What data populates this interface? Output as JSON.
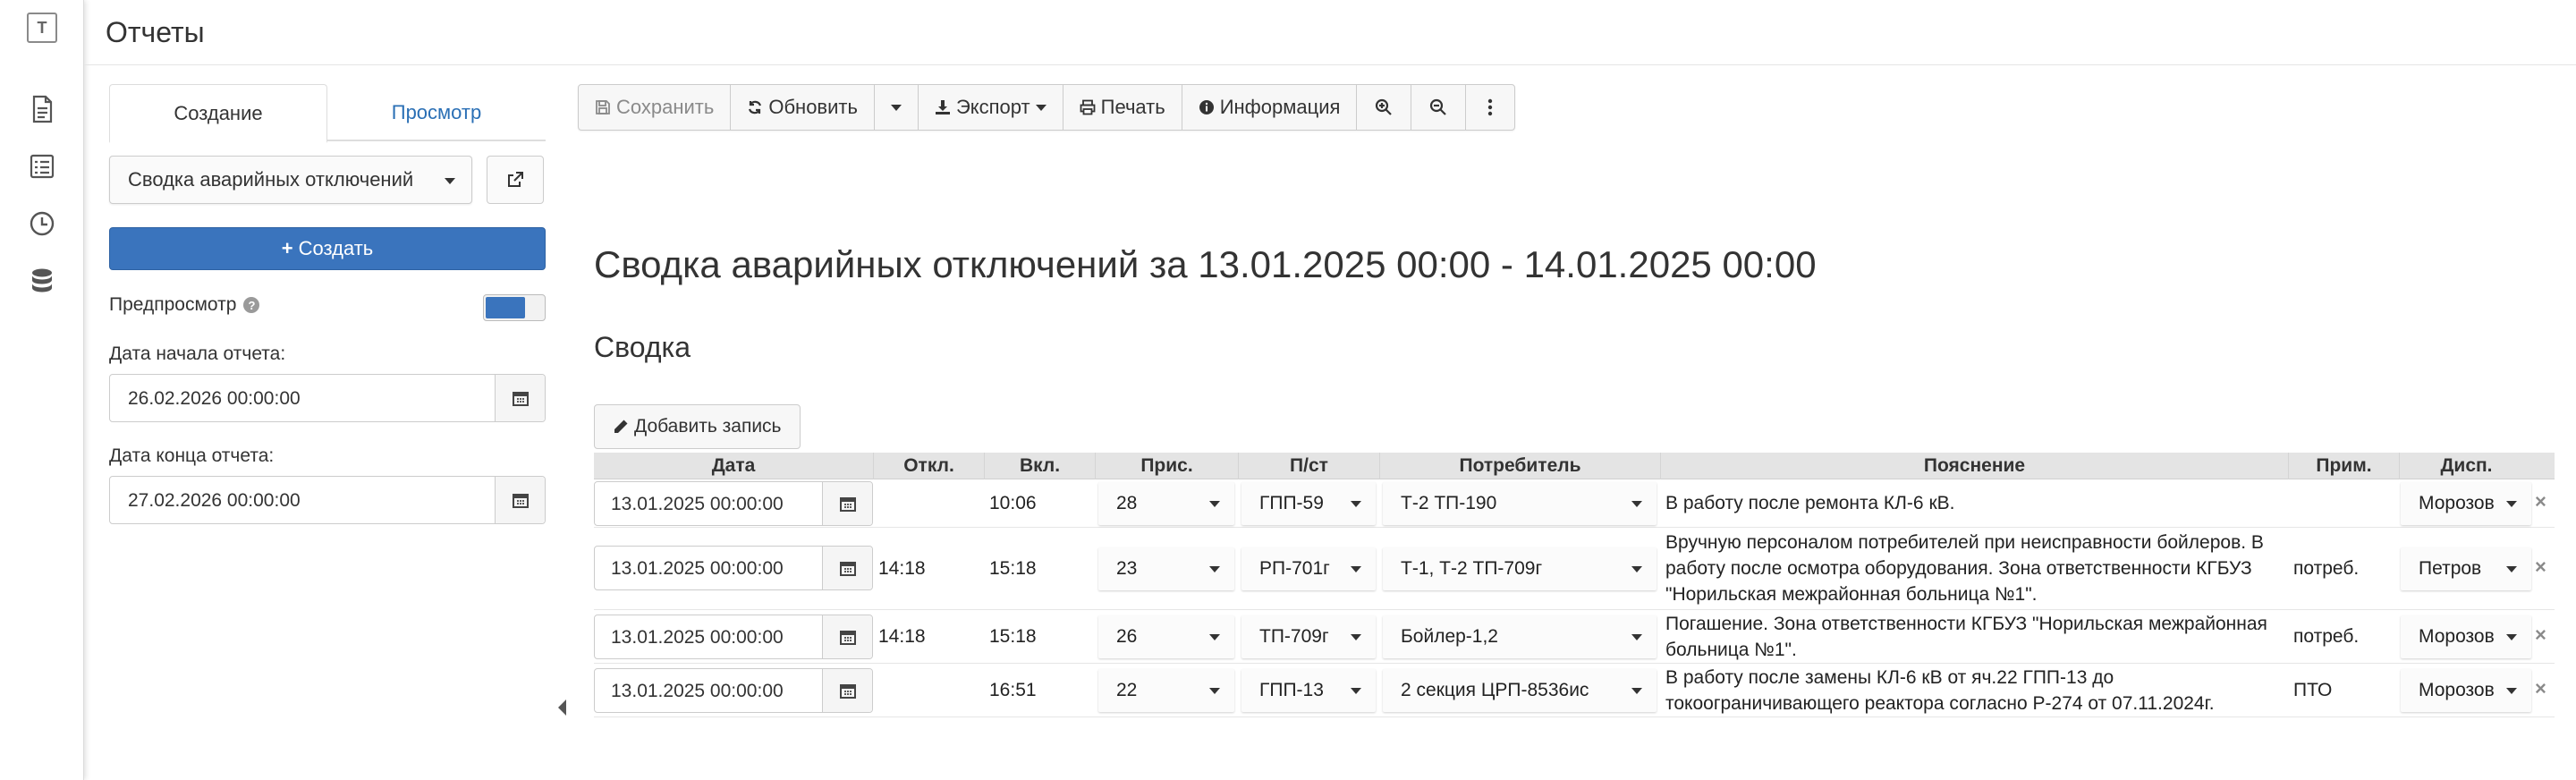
{
  "app": {
    "logo_letter": "T",
    "page_title": "Отчеты"
  },
  "rail": {
    "items": [
      {
        "icon": "document-icon"
      },
      {
        "icon": "checklist-icon"
      },
      {
        "icon": "clock-icon"
      },
      {
        "icon": "database-icon"
      }
    ]
  },
  "left_panel": {
    "tabs": [
      {
        "label": "Создание",
        "active": true
      },
      {
        "label": "Просмотр",
        "active": false
      }
    ],
    "report_select": "Сводка аварийных отключений",
    "create_label": "Создать",
    "preview_label": "Предпросмотр",
    "preview_help": "?",
    "preview_enabled": true,
    "start_label": "Дата начала отчета:",
    "start_value": "26.02.2026 00:00:00",
    "end_label": "Дата конца отчета:",
    "end_value": "27.02.2026 00:00:00"
  },
  "toolbar": {
    "save": "Сохранить",
    "refresh": "Обновить",
    "export": "Экспорт",
    "print": "Печать",
    "info": "Информация"
  },
  "report": {
    "title_prefix": "Сводка аварийных отключений за",
    "date_from": "13.01.2025 00:00",
    "dash": "-",
    "date_to": "14.01.2025 00:00",
    "section": "Сводка",
    "add_label": "Добавить запись",
    "columns": [
      "Дата",
      "Откл.",
      "Вкл.",
      "Прис.",
      "П/ст",
      "Потребитель",
      "Пояснение",
      "Прим.",
      "Дисп."
    ],
    "rows": [
      {
        "date": "13.01.2025 00:00:00",
        "off": "",
        "on": "10:06",
        "feeder": "28",
        "substation": "ГПП-59",
        "consumer": "Т-2 ТП-190",
        "note": "В работу после ремонта КЛ-6 кВ.",
        "remark": "",
        "dispatcher": "Морозов"
      },
      {
        "date": "13.01.2025 00:00:00",
        "off": "14:18",
        "on": "15:18",
        "feeder": "23",
        "substation": "РП-701г",
        "consumer": "Т-1, Т-2 ТП-709г",
        "note": "Вручную персоналом потребителей при неисправности бойлеров. В работу после осмотра оборудования. Зона ответственности КГБУЗ \"Норильская межрайонная больница №1\".",
        "remark": "потреб.",
        "dispatcher": "Петров"
      },
      {
        "date": "13.01.2025 00:00:00",
        "off": "14:18",
        "on": "15:18",
        "feeder": "26",
        "substation": "ТП-709г",
        "consumer": "Бойлер-1,2",
        "note": "Погашение. Зона ответственности КГБУЗ \"Норильская межрайонная больница №1\".",
        "remark": "потреб.",
        "dispatcher": "Морозов"
      },
      {
        "date": "13.01.2025 00:00:00",
        "off": "",
        "on": "16:51",
        "feeder": "22",
        "substation": "ГПП-13",
        "consumer": "2 секция ЦРП-8536ис",
        "note": "В работу после замены КЛ-6 кВ от яч.22 ГПП-13 до токоограничивающего реактора согласно Р-274 от 07.11.2024г.",
        "remark": "ПТО",
        "dispatcher": "Морозов"
      }
    ]
  },
  "colors": {
    "primary": "#3a74bd",
    "link": "#2a6fb5",
    "grid_header": "#e4e4e4"
  }
}
